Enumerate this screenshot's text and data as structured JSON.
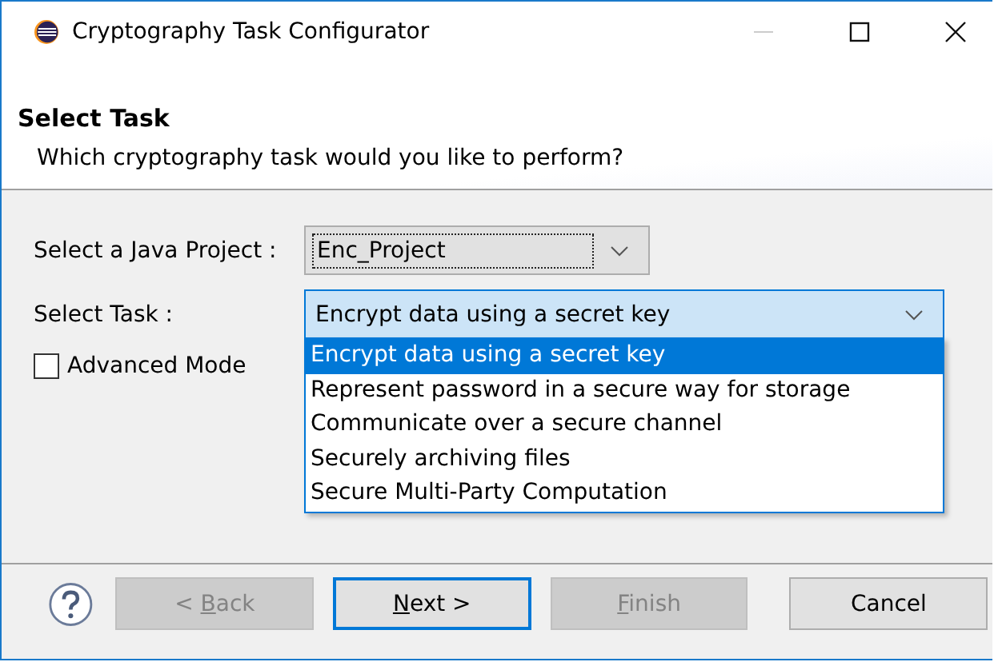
{
  "window": {
    "title": "Cryptography Task Configurator"
  },
  "header": {
    "title": "Select Task",
    "description": "Which cryptography task would you like to perform?"
  },
  "project": {
    "label": "Select a Java Project :",
    "value": "Enc_Project"
  },
  "task": {
    "label": "Select Task :",
    "value": "Encrypt data using a secret key",
    "expanded": true,
    "options": [
      {
        "label": "Encrypt data using a secret key",
        "selected": true
      },
      {
        "label": "Represent password in a secure way for storage",
        "selected": false
      },
      {
        "label": "Communicate over a secure channel",
        "selected": false
      },
      {
        "label": "Securely archiving files",
        "selected": false
      },
      {
        "label": "Secure Multi-Party Computation",
        "selected": false
      }
    ]
  },
  "advanced_mode": {
    "label": "Advanced Mode",
    "checked": false
  },
  "buttons": [
    {
      "prefix": "< ",
      "mnemonic": "B",
      "suffix": "ack",
      "disabled": true,
      "default": false
    },
    {
      "mnemonic": "N",
      "suffix": "ext >",
      "disabled": false,
      "default": true
    },
    {
      "mnemonic": "F",
      "suffix": "inish",
      "disabled": true,
      "default": false
    },
    {
      "suffix": "Cancel",
      "disabled": false,
      "default": false
    }
  ]
}
